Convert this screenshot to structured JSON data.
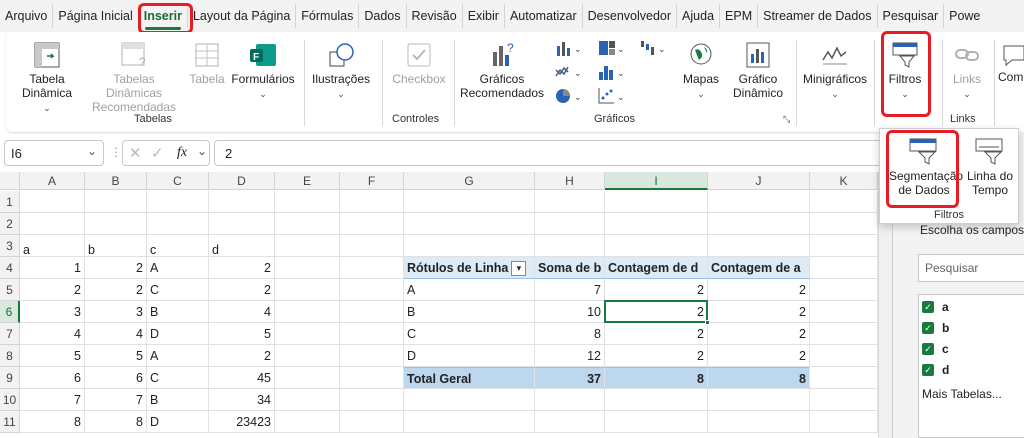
{
  "tabs": [
    "Arquivo",
    "Página Inicial",
    "Inserir",
    "Layout da Página",
    "Fórmulas",
    "Dados",
    "Revisão",
    "Exibir",
    "Automatizar",
    "Desenvolvedor",
    "Ajuda",
    "EPM",
    "Streamer de Dados",
    "Pesquisar",
    "Powe"
  ],
  "active_tab": "Inserir",
  "ribbon": {
    "tabela_dinamica": "Tabela Dinâmica",
    "tabelas_recomendadas": "Tabelas Dinâmicas Recomendadas",
    "tabela": "Tabela",
    "formularios": "Formulários",
    "tabelas_group": "Tabelas",
    "ilustracoes": "Ilustrações",
    "checkbox": "Checkbox",
    "controles_group": "Controles",
    "graficos_recomendados": "Gráficos Recomendados",
    "mapas": "Mapas",
    "grafico_dinamico": "Gráfico Dinâmico",
    "graficos_group": "Gráficos",
    "minigraficos": "Minigráficos",
    "filtros": "Filtros",
    "links": "Links",
    "links_group": "Links",
    "com": "Com"
  },
  "filters_popup": {
    "segmentacao": "Segmentação de Dados",
    "linha_tempo": "Linha do Tempo",
    "group": "Filtros"
  },
  "formula_bar": {
    "name_box": "I6",
    "value": "2",
    "fx": "fx"
  },
  "columns": [
    "A",
    "B",
    "C",
    "D",
    "E",
    "F",
    "G",
    "H",
    "I",
    "J",
    "K"
  ],
  "selected_column": "I",
  "rows": [
    "1",
    "2",
    "3",
    "4",
    "5",
    "6",
    "7",
    "8",
    "9",
    "10",
    "11"
  ],
  "selected_row": "6",
  "data": {
    "headers": [
      "a",
      "b",
      "c",
      "d"
    ],
    "rows": [
      [
        "1",
        "2",
        "A",
        "2"
      ],
      [
        "2",
        "2",
        "C",
        "2"
      ],
      [
        "3",
        "3",
        "B",
        "4"
      ],
      [
        "4",
        "4",
        "D",
        "5"
      ],
      [
        "5",
        "5",
        "A",
        "2"
      ],
      [
        "6",
        "6",
        "C",
        "45"
      ],
      [
        "7",
        "7",
        "B",
        "34"
      ],
      [
        "8",
        "8",
        "D",
        "23423"
      ]
    ]
  },
  "pivot": {
    "headers": [
      "Rótulos de Linha",
      "Soma de b",
      "Contagem de d",
      "Contagem de a"
    ],
    "rows": [
      [
        "A",
        "7",
        "2",
        "2"
      ],
      [
        "B",
        "10",
        "2",
        "2"
      ],
      [
        "C",
        "8",
        "2",
        "2"
      ],
      [
        "D",
        "12",
        "2",
        "2"
      ]
    ],
    "total": [
      "Total Geral",
      "37",
      "8",
      "8"
    ]
  },
  "pane": {
    "choose": "Escolha os campos p",
    "search_placeholder": "Pesquisar",
    "fields": [
      "a",
      "b",
      "c",
      "d"
    ],
    "more": "Mais Tabelas..."
  }
}
